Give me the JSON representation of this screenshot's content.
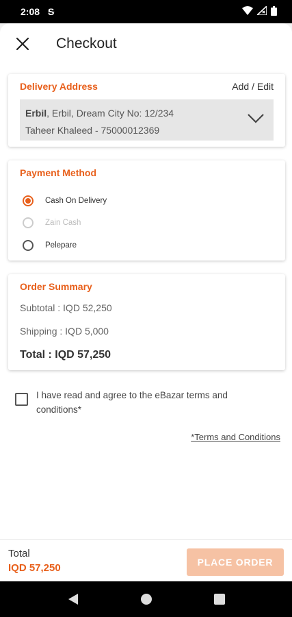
{
  "status_bar": {
    "time": "2:08",
    "sync_glyph": "S"
  },
  "appbar": {
    "title": "Checkout"
  },
  "delivery": {
    "title": "Delivery Address",
    "edit_label": "Add / Edit",
    "city": "Erbil",
    "address_rest": ", Erbil, Dream City No: 12/234",
    "contact": "Taheer Khaleed - 75000012369"
  },
  "payment": {
    "title": "Payment Method",
    "options": [
      {
        "label": "Cash On Delivery",
        "selected": true,
        "enabled": true
      },
      {
        "label": "Zain Cash",
        "selected": false,
        "enabled": false
      },
      {
        "label": "Pelepare",
        "selected": false,
        "enabled": true
      }
    ]
  },
  "summary": {
    "title": "Order Summary",
    "subtotal": "Subtotal : IQD 52,250",
    "shipping": "Shipping : IQD 5,000",
    "total": "Total : IQD 57,250"
  },
  "terms": {
    "text": "I have read and agree to the eBazar terms and conditions*",
    "link": "*Terms and Conditions",
    "checked": false
  },
  "bottom": {
    "total_label": "Total",
    "total_value": "IQD 57,250",
    "place_order": "PLACE ORDER"
  },
  "colors": {
    "accent": "#e8601c",
    "button_disabled": "#f6c2a4"
  }
}
